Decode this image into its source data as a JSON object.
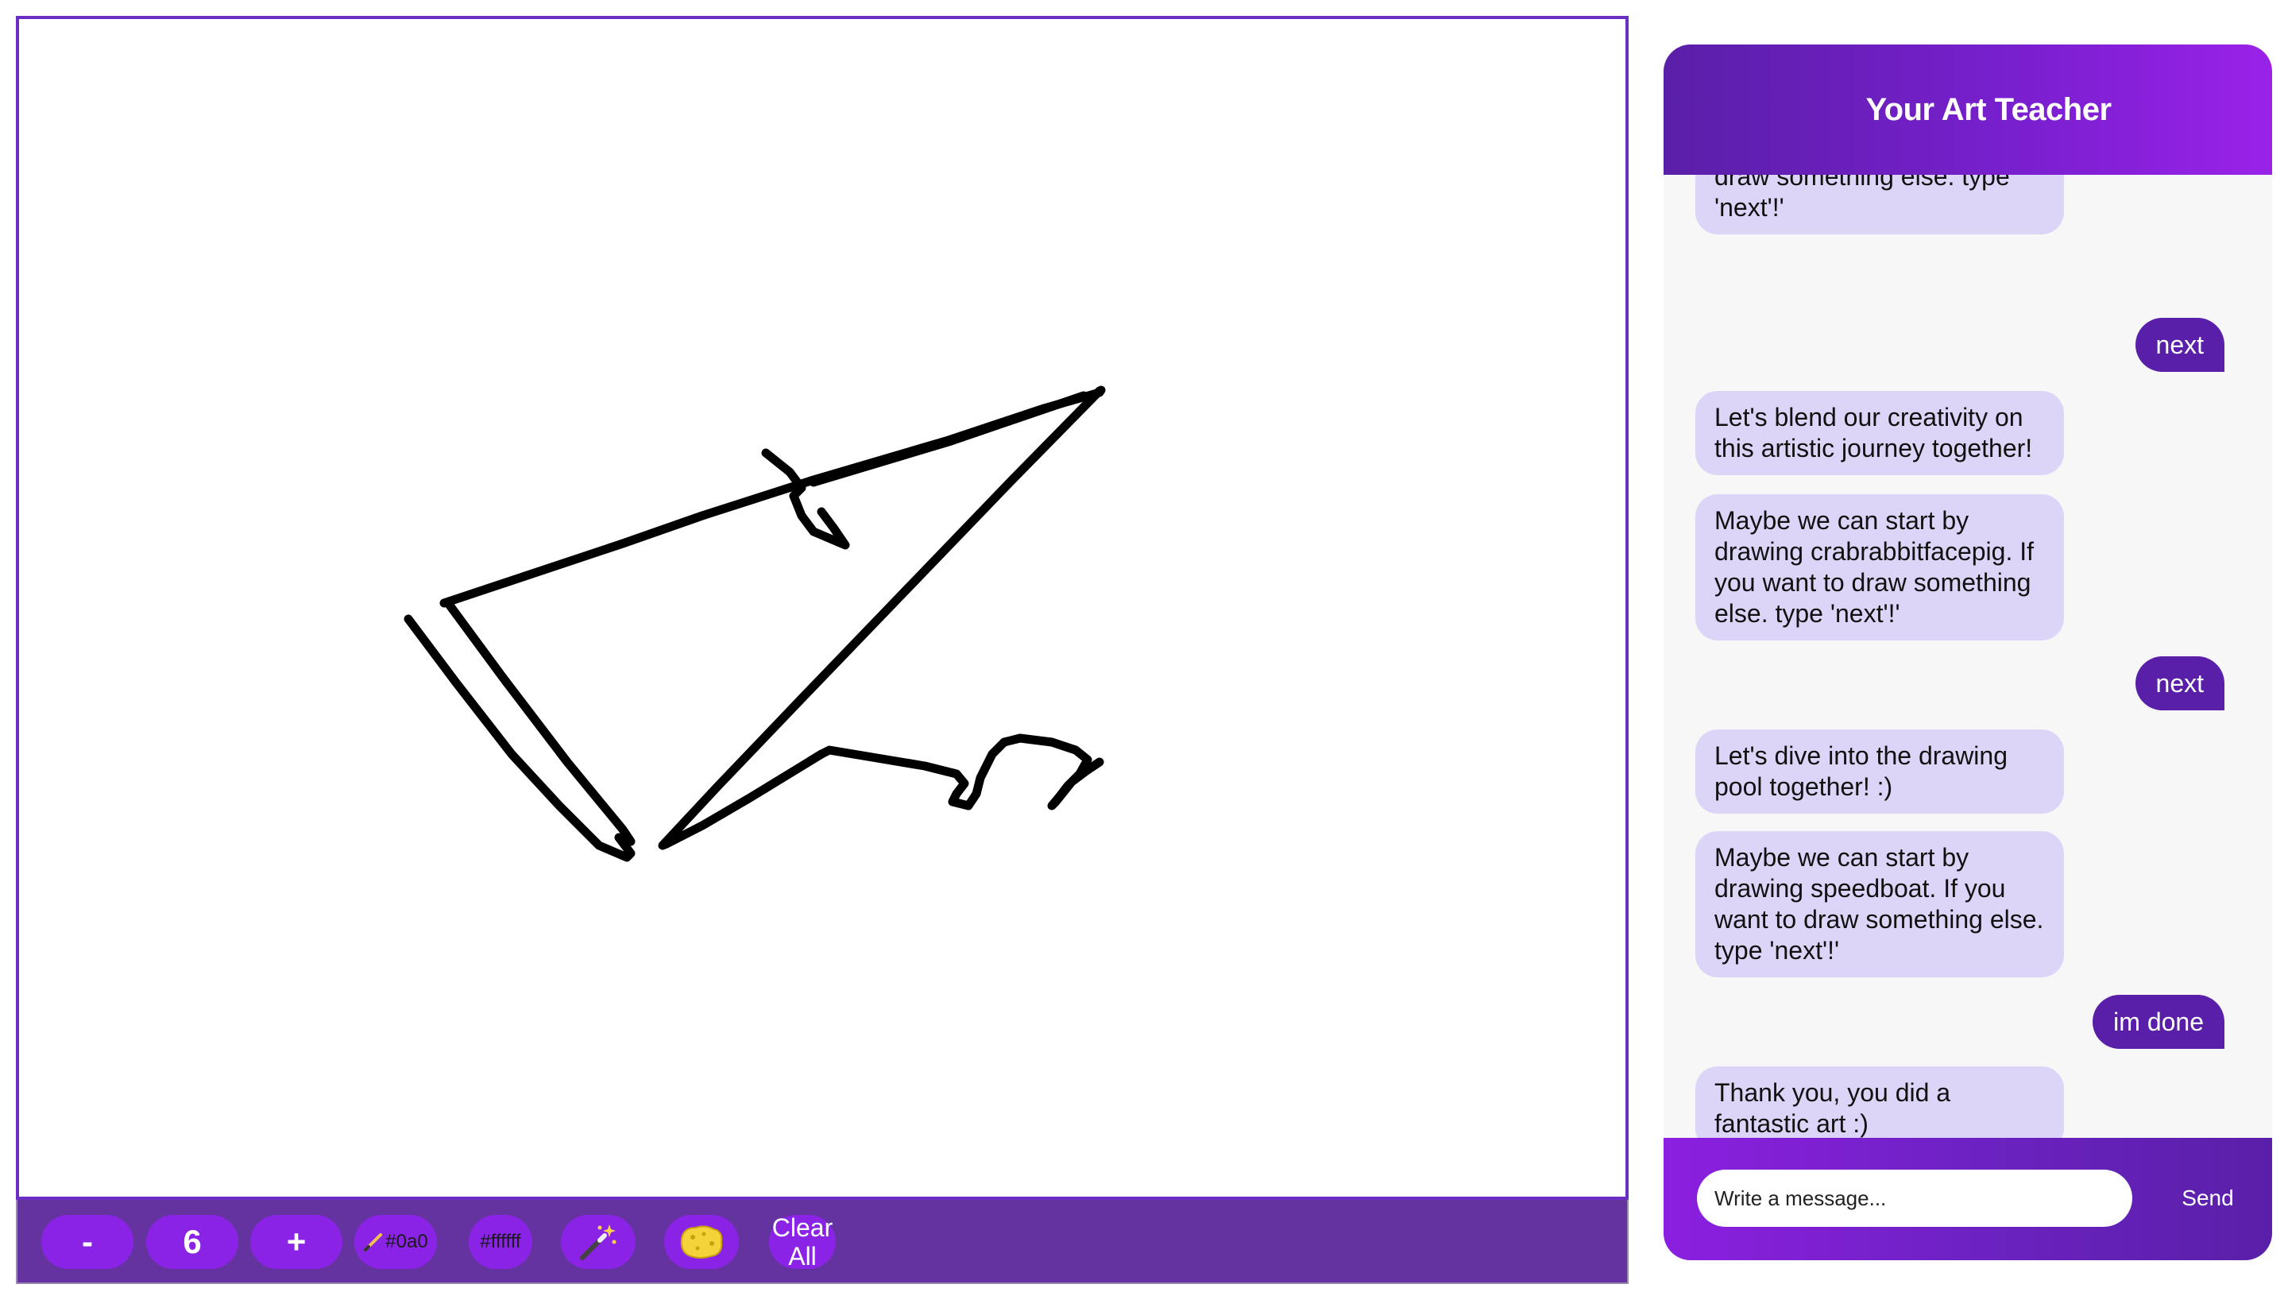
{
  "toolbar": {
    "decrease_label": "-",
    "brush_size": "6",
    "increase_label": "+",
    "pen_color_label": "#0a0",
    "bg_color_label": "#ffffff",
    "clear_label_line1": "Clear",
    "clear_label_line2": "All"
  },
  "icons": {
    "pen": "pen-icon",
    "magic": "magic-wand-icon",
    "eraser": "sponge-eraser-icon"
  },
  "colors": {
    "accent": "#5a1fa8",
    "toolbar_bg": "#65339f",
    "tool_button": "#8a23e6",
    "bot_bubble": "#ddd5f7",
    "stroke": "#000000"
  },
  "chat": {
    "title": "Your Art Teacher",
    "messages": [
      {
        "from": "bot",
        "text": "drawing peas. If you want to draw something else. type 'next'!'"
      },
      {
        "from": "user",
        "text": "next"
      },
      {
        "from": "bot",
        "text": "Let's blend our creativity on this artistic journey together!"
      },
      {
        "from": "bot",
        "text": "Maybe we can start by drawing crabrabbitfacepig. If you want to draw something else. type 'next'!'"
      },
      {
        "from": "user",
        "text": "next"
      },
      {
        "from": "bot",
        "text": "Let's dive into the drawing pool together! :)"
      },
      {
        "from": "bot",
        "text": "Maybe we can start by drawing speedboat. If you want to draw something else. type 'next'!'"
      },
      {
        "from": "user",
        "text": "im done"
      },
      {
        "from": "bot",
        "text": "Thank you, you did a fantastic art :)"
      }
    ],
    "input_placeholder": "Write a message...",
    "send_label": "Send"
  }
}
